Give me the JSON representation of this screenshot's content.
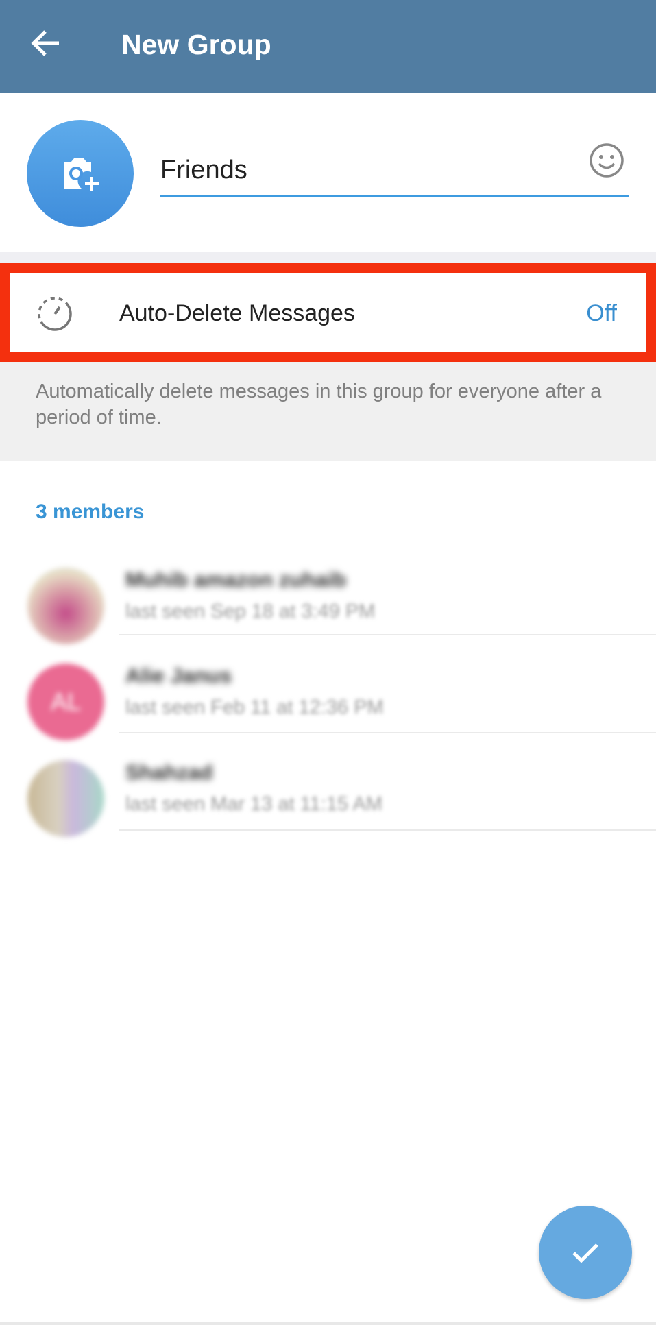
{
  "header": {
    "title": "New Group",
    "back_icon": "arrow-left-icon",
    "color": "#517da2"
  },
  "group": {
    "name_value": "Friends",
    "photo_icon": "camera-add-icon",
    "emoji_icon": "smiley-icon"
  },
  "auto_delete": {
    "label": "Auto-Delete Messages",
    "value": "Off",
    "icon": "timer-icon",
    "description": "Automatically delete messages in this group for everyone after a period of time.",
    "highlight_color": "#f4300e"
  },
  "members": {
    "header": "3 members",
    "items": [
      {
        "name": "Muhib amazon zuhaib",
        "status": "last seen Sep 18 at 3:49 PM",
        "initials": ""
      },
      {
        "name": "Alie Janus",
        "status": "last seen Feb 11 at 12:36 PM",
        "initials": "AL"
      },
      {
        "name": "Shahzad",
        "status": "last seen Mar 13 at 11:15 AM",
        "initials": ""
      }
    ]
  },
  "fab": {
    "icon": "checkmark-icon",
    "color": "#65a9e0"
  }
}
